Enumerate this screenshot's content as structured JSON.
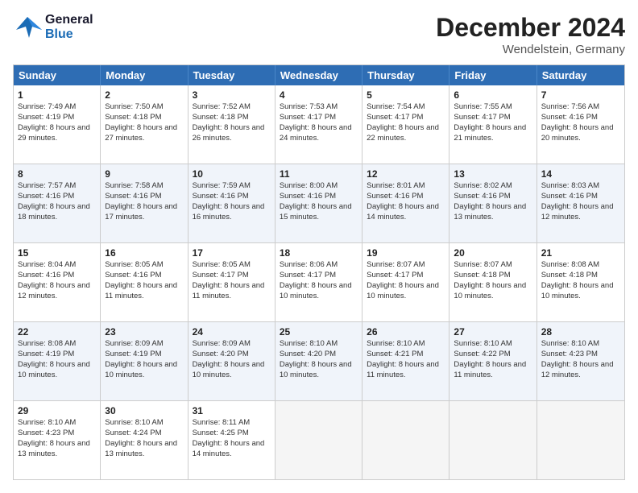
{
  "logo": {
    "line1": "General",
    "line2": "Blue"
  },
  "title": "December 2024",
  "subtitle": "Wendelstein, Germany",
  "header_days": [
    "Sunday",
    "Monday",
    "Tuesday",
    "Wednesday",
    "Thursday",
    "Friday",
    "Saturday"
  ],
  "weeks": [
    [
      {
        "day": "1",
        "sunrise": "7:49 AM",
        "sunset": "4:19 PM",
        "daylight": "8 hours and 29 minutes."
      },
      {
        "day": "2",
        "sunrise": "7:50 AM",
        "sunset": "4:18 PM",
        "daylight": "8 hours and 27 minutes."
      },
      {
        "day": "3",
        "sunrise": "7:52 AM",
        "sunset": "4:18 PM",
        "daylight": "8 hours and 26 minutes."
      },
      {
        "day": "4",
        "sunrise": "7:53 AM",
        "sunset": "4:17 PM",
        "daylight": "8 hours and 24 minutes."
      },
      {
        "day": "5",
        "sunrise": "7:54 AM",
        "sunset": "4:17 PM",
        "daylight": "8 hours and 22 minutes."
      },
      {
        "day": "6",
        "sunrise": "7:55 AM",
        "sunset": "4:17 PM",
        "daylight": "8 hours and 21 minutes."
      },
      {
        "day": "7",
        "sunrise": "7:56 AM",
        "sunset": "4:16 PM",
        "daylight": "8 hours and 20 minutes."
      }
    ],
    [
      {
        "day": "8",
        "sunrise": "7:57 AM",
        "sunset": "4:16 PM",
        "daylight": "8 hours and 18 minutes."
      },
      {
        "day": "9",
        "sunrise": "7:58 AM",
        "sunset": "4:16 PM",
        "daylight": "8 hours and 17 minutes."
      },
      {
        "day": "10",
        "sunrise": "7:59 AM",
        "sunset": "4:16 PM",
        "daylight": "8 hours and 16 minutes."
      },
      {
        "day": "11",
        "sunrise": "8:00 AM",
        "sunset": "4:16 PM",
        "daylight": "8 hours and 15 minutes."
      },
      {
        "day": "12",
        "sunrise": "8:01 AM",
        "sunset": "4:16 PM",
        "daylight": "8 hours and 14 minutes."
      },
      {
        "day": "13",
        "sunrise": "8:02 AM",
        "sunset": "4:16 PM",
        "daylight": "8 hours and 13 minutes."
      },
      {
        "day": "14",
        "sunrise": "8:03 AM",
        "sunset": "4:16 PM",
        "daylight": "8 hours and 12 minutes."
      }
    ],
    [
      {
        "day": "15",
        "sunrise": "8:04 AM",
        "sunset": "4:16 PM",
        "daylight": "8 hours and 12 minutes."
      },
      {
        "day": "16",
        "sunrise": "8:05 AM",
        "sunset": "4:16 PM",
        "daylight": "8 hours and 11 minutes."
      },
      {
        "day": "17",
        "sunrise": "8:05 AM",
        "sunset": "4:17 PM",
        "daylight": "8 hours and 11 minutes."
      },
      {
        "day": "18",
        "sunrise": "8:06 AM",
        "sunset": "4:17 PM",
        "daylight": "8 hours and 10 minutes."
      },
      {
        "day": "19",
        "sunrise": "8:07 AM",
        "sunset": "4:17 PM",
        "daylight": "8 hours and 10 minutes."
      },
      {
        "day": "20",
        "sunrise": "8:07 AM",
        "sunset": "4:18 PM",
        "daylight": "8 hours and 10 minutes."
      },
      {
        "day": "21",
        "sunrise": "8:08 AM",
        "sunset": "4:18 PM",
        "daylight": "8 hours and 10 minutes."
      }
    ],
    [
      {
        "day": "22",
        "sunrise": "8:08 AM",
        "sunset": "4:19 PM",
        "daylight": "8 hours and 10 minutes."
      },
      {
        "day": "23",
        "sunrise": "8:09 AM",
        "sunset": "4:19 PM",
        "daylight": "8 hours and 10 minutes."
      },
      {
        "day": "24",
        "sunrise": "8:09 AM",
        "sunset": "4:20 PM",
        "daylight": "8 hours and 10 minutes."
      },
      {
        "day": "25",
        "sunrise": "8:10 AM",
        "sunset": "4:20 PM",
        "daylight": "8 hours and 10 minutes."
      },
      {
        "day": "26",
        "sunrise": "8:10 AM",
        "sunset": "4:21 PM",
        "daylight": "8 hours and 11 minutes."
      },
      {
        "day": "27",
        "sunrise": "8:10 AM",
        "sunset": "4:22 PM",
        "daylight": "8 hours and 11 minutes."
      },
      {
        "day": "28",
        "sunrise": "8:10 AM",
        "sunset": "4:23 PM",
        "daylight": "8 hours and 12 minutes."
      }
    ],
    [
      {
        "day": "29",
        "sunrise": "8:10 AM",
        "sunset": "4:23 PM",
        "daylight": "8 hours and 13 minutes."
      },
      {
        "day": "30",
        "sunrise": "8:10 AM",
        "sunset": "4:24 PM",
        "daylight": "8 hours and 13 minutes."
      },
      {
        "day": "31",
        "sunrise": "8:11 AM",
        "sunset": "4:25 PM",
        "daylight": "8 hours and 14 minutes."
      },
      null,
      null,
      null,
      null
    ]
  ],
  "labels": {
    "sunrise": "Sunrise: ",
    "sunset": "Sunset: ",
    "daylight": "Daylight: "
  }
}
